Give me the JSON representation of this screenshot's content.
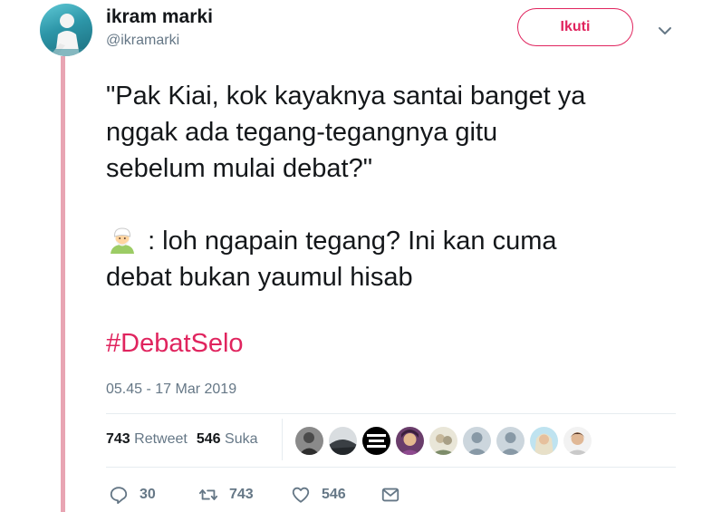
{
  "user": {
    "display_name": "ikram marki",
    "handle": "@ikramarki",
    "follow_label": "Ikuti"
  },
  "tweet": {
    "line1": "\"Pak Kiai, kok kayaknya santai banget ya",
    "line2": "nggak ada tegang-tegangnya gitu",
    "line3": "sebelum mulai debat?\"",
    "line4": ": loh ngapain tegang? Ini kan cuma",
    "line5": "debat bukan yaumul hisab",
    "emoji": "man-with-turban-emoji",
    "hashtag": "#DebatSelo",
    "timestamp": "05.45 - 17 Mar 2019"
  },
  "stats": {
    "retweet_count": "743",
    "retweet_label": "Retweet",
    "like_count": "546",
    "like_label": "Suka"
  },
  "actions": {
    "reply_count": "30",
    "retweet_count": "743",
    "like_count": "546"
  },
  "colors": {
    "accent": "#e0245e",
    "thread_line": "#e8a5b3",
    "muted_text": "#657786",
    "text": "#14171a",
    "divider": "#e6ecf0"
  }
}
